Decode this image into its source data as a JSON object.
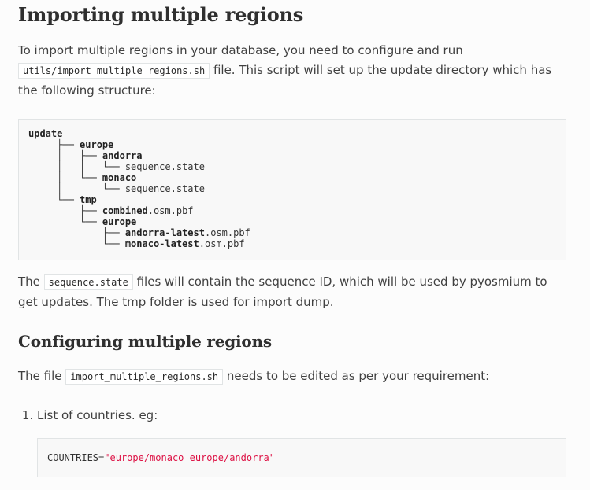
{
  "section_import": {
    "heading": "Importing multiple regions",
    "intro_before": "To import multiple regions in your database, you need to configure and run",
    "intro_code": "utils/import_multiple_regions.sh",
    "intro_after": " file. This script will set up the update directory which has the following structure:"
  },
  "tree": {
    "root": "update",
    "europe": "europe",
    "andorra": "andorra",
    "andorra_state_name": "sequence",
    "andorra_state_ext": ".state",
    "monaco": "monaco",
    "monaco_state_name": "sequence",
    "monaco_state_ext": ".state",
    "tmp": "tmp",
    "combined_name": "combined",
    "combined_ext": ".osm.pbf",
    "tmp_europe": "europe",
    "andorra_latest_name": "andorra-latest",
    "andorra_latest_ext": ".osm.pbf",
    "monaco_latest_name": "monaco-latest",
    "monaco_latest_ext": ".osm.pbf"
  },
  "sequence_para": {
    "before": "The ",
    "code": "sequence.state",
    "after": " files will contain the sequence ID, which will be used by pyosmium to get updates. The tmp folder is used for import dump."
  },
  "section_config": {
    "heading": "Configuring multiple regions",
    "file_before": "The file ",
    "file_code": "import_multiple_regions.sh",
    "file_after": " needs to be edited as per your requirement:"
  },
  "steps": [
    {
      "label": "List of countries. eg:"
    }
  ],
  "countries_code": {
    "variable": "COUNTRIES",
    "operator": "=",
    "value": "\"europe/monaco europe/andorra\""
  }
}
